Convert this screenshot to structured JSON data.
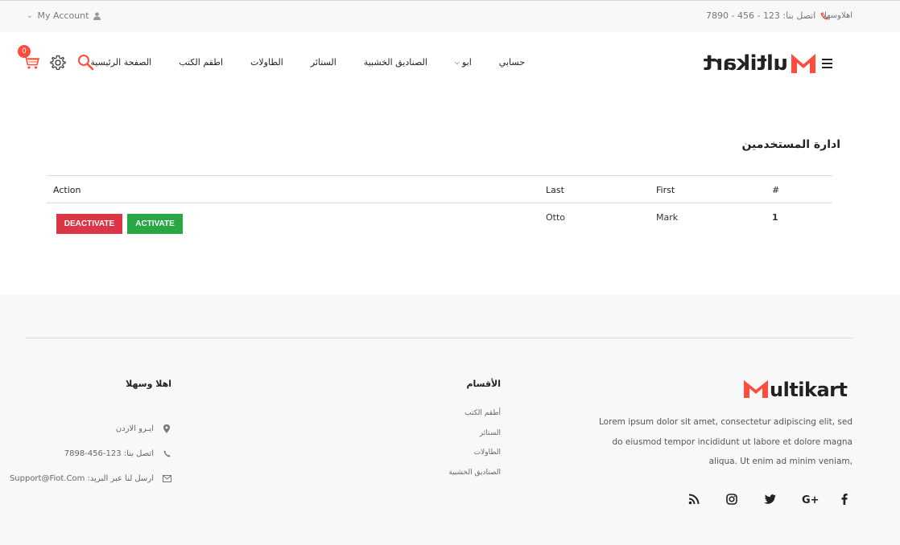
{
  "topbar": {
    "welcome": "اهلاوسهلا",
    "phone_label": "اتصل بنا: 123 - 456 - 7890",
    "account_label": "My Account"
  },
  "brand": {
    "logo_text": "ultikart",
    "logo_letter": "M",
    "accent_color": "#ff4c3b"
  },
  "nav": {
    "items": [
      {
        "label": "حسابي",
        "has_chevron": false
      },
      {
        "label": "ابو",
        "has_chevron": true
      },
      {
        "label": "الصناديق الخشبية",
        "has_chevron": false
      },
      {
        "label": "الستائر",
        "has_chevron": false
      },
      {
        "label": "الطاولات",
        "has_chevron": false
      },
      {
        "label": "اطقم الكتب",
        "has_chevron": false
      },
      {
        "label": "الصفحة الرئيسية",
        "has_chevron": false
      }
    ],
    "cart_count": "0"
  },
  "main": {
    "title": "ادارة المستخدمين",
    "table": {
      "headers": {
        "num": "#",
        "first": "First",
        "last": "Last",
        "action": "Action"
      },
      "rows": [
        {
          "num": "1",
          "first": "Mark",
          "last": "Otto",
          "activate_label": "ACTIVATE",
          "deactivate_label": "DEACTIVATE"
        }
      ]
    }
  },
  "footer": {
    "logo_text": "ultikart",
    "description": "Lorem ipsum dolor sit amet, consectetur adipiscing elit, sed do eiusmod tempor incididunt ut labore et dolore magna aliqua. Ut enim ad minim veniam,",
    "social_icons": [
      "facebook-icon",
      "google-plus-icon",
      "twitter-icon",
      "instagram-icon",
      "rss-icon"
    ],
    "categories": {
      "title": "الأقسام",
      "items": [
        "أطقم الكتب",
        "الستائر",
        "الطاولات",
        "الصناديق الخشبية"
      ]
    },
    "welcome": {
      "title": "اهلا وسهلا",
      "address": "ايـرو الاردن",
      "phone": "اتصل بنا: 123-456-7898",
      "email": "ارسل لنا عبر البريد: Support@Fiot.Com"
    }
  }
}
